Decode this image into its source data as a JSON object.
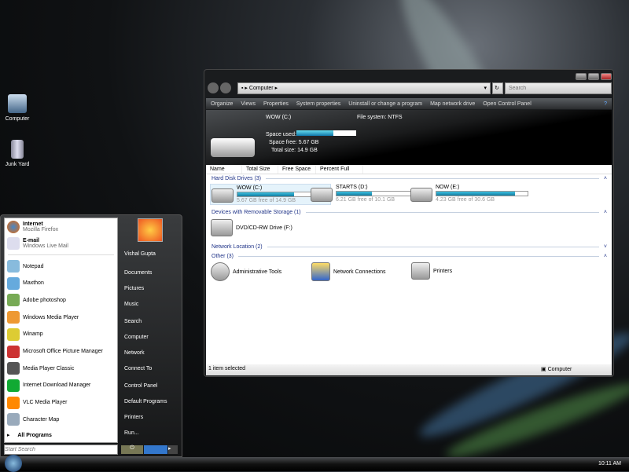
{
  "desktop": {
    "icons": [
      {
        "label": "Computer"
      },
      {
        "label": "Junk Yard"
      }
    ]
  },
  "explorer": {
    "breadcrumb": "Computer",
    "search_placeholder": "Search",
    "toolbar": [
      "Organize",
      "Views",
      "Properties",
      "System properties",
      "Uninstall or change a program",
      "Map network drive",
      "Open Control Panel"
    ],
    "details": {
      "name": "WOW (C:)",
      "filesystem": "File system: NTFS",
      "used_label": "Space used:",
      "free_label": "Space free:",
      "free": "5.67 GB",
      "total_label": "Total size:",
      "total": "14.9 GB",
      "used_fraction": 0.62
    },
    "columns": [
      "Name",
      "Total Size",
      "Free Space",
      "Percent Full"
    ],
    "groups": {
      "hdd": "Hard Disk Drives (3)",
      "removable": "Devices with Removable Storage (1)",
      "network": "Network Location (2)",
      "other": "Other (3)"
    },
    "drives": [
      {
        "name": "WOW (C:)",
        "info": "5.67 GB free of 14.9 GB",
        "used_percent": 62
      },
      {
        "name": "STARTS (D:)",
        "info": "6.21 GB free of 10.1 GB",
        "used_percent": 39
      },
      {
        "name": "NOW (E:)",
        "info": "4.23 GB free of 30.6 GB",
        "used_percent": 86
      }
    ],
    "removable": "DVD/CD-RW Drive (F:)",
    "other": [
      "Administrative Tools",
      "Network Connections",
      "Printers"
    ],
    "status_left": "1 item selected",
    "status_right": "Computer"
  },
  "start_menu": {
    "pinned": [
      {
        "title": "Internet",
        "sub": "Mozilla Firefox"
      },
      {
        "title": "E-mail",
        "sub": "Windows Live Mail"
      }
    ],
    "programs": [
      "Notepad",
      "Maxthon",
      "Adobe photoshop",
      "Windows Media Player",
      "Winamp",
      "Microsoft Office Picture Manager",
      "Media Player Classic",
      "Internet Download Manager",
      "VLC Media Player",
      "Character Map"
    ],
    "all_programs": "All Programs",
    "search_placeholder": "Start Search",
    "right": [
      "Vishal Gupta",
      "Documents",
      "Pictures",
      "Music",
      "Search",
      "Computer",
      "Network",
      "Connect To",
      "Control Panel",
      "Default Programs",
      "Printers",
      "Run..."
    ]
  },
  "taskbar": {
    "clock": "10:11 AM"
  }
}
